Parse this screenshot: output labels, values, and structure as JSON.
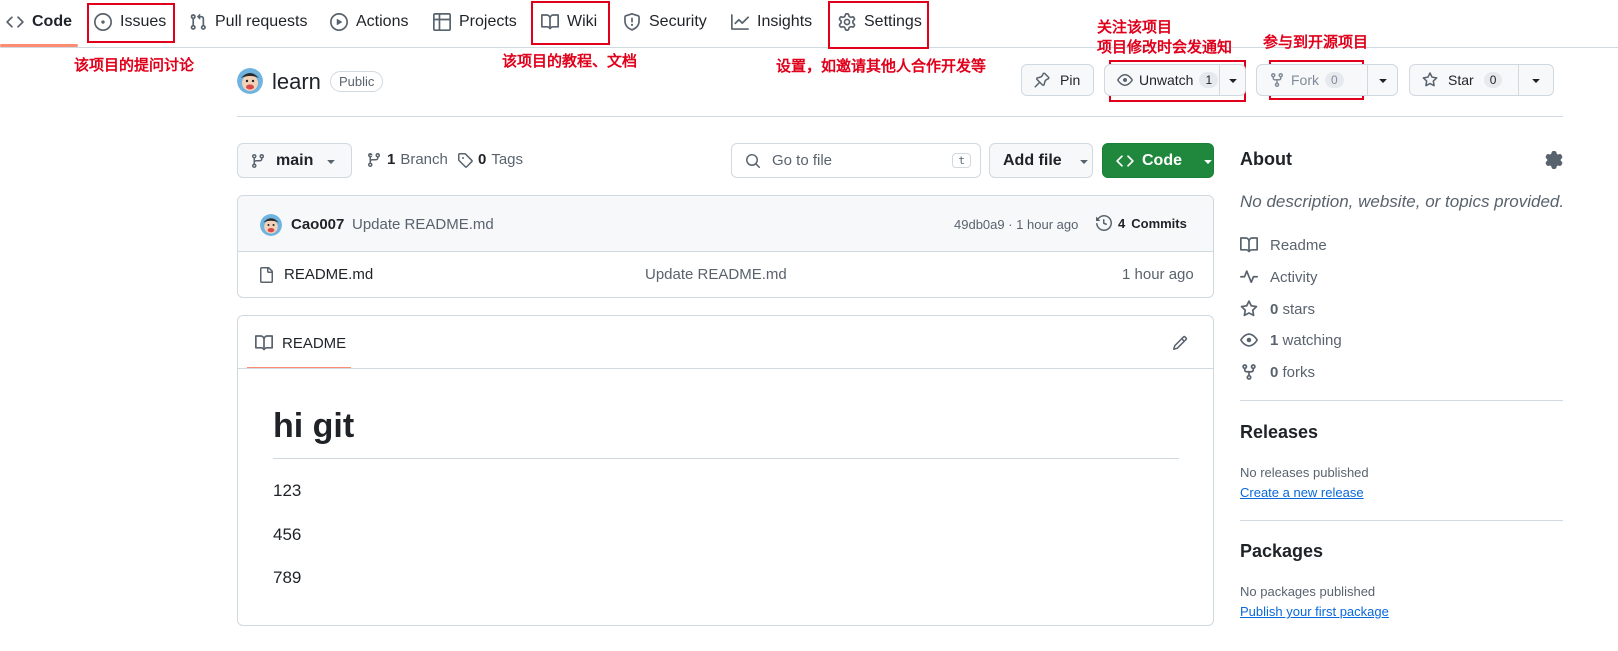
{
  "nav": {
    "tabs": [
      {
        "label": "Code",
        "icon": "code-icon"
      },
      {
        "label": "Issues",
        "icon": "issue-opened-icon"
      },
      {
        "label": "Pull requests",
        "icon": "git-pull-request-icon"
      },
      {
        "label": "Actions",
        "icon": "play-icon"
      },
      {
        "label": "Projects",
        "icon": "table-icon"
      },
      {
        "label": "Wiki",
        "icon": "book-icon"
      },
      {
        "label": "Security",
        "icon": "shield-icon"
      },
      {
        "label": "Insights",
        "icon": "graph-icon"
      },
      {
        "label": "Settings",
        "icon": "gear-icon"
      }
    ]
  },
  "annotations": {
    "issues": "该项目的提问讨论",
    "wiki": "该项目的教程、文档",
    "settings": "设置，如邀请其他人合作开发等",
    "watch_line1": "关注该项目",
    "watch_line2": "项目修改时会发通知",
    "fork": "参与到开源项目"
  },
  "repo": {
    "name": "learn",
    "visibility": "Public",
    "pin_label": "Pin",
    "watch_label": "Unwatch",
    "watch_count": "1",
    "fork_label": "Fork",
    "fork_count": "0",
    "star_label": "Star",
    "star_count": "0"
  },
  "toolbar": {
    "branch": "main",
    "branches_count": "1",
    "branches_label": "Branch",
    "tags_count": "0",
    "tags_label": "Tags",
    "search_placeholder": "Go to file",
    "search_shortcut": "t",
    "add_file_label": "Add file",
    "code_label": "Code"
  },
  "commit": {
    "author": "Cao007",
    "message": "Update README.md",
    "hash_time": "49db0a9 · 1 hour ago",
    "commits_count": "4",
    "commits_label": "Commits"
  },
  "files": [
    {
      "name": "README.md",
      "message": "Update README.md",
      "time": "1 hour ago"
    }
  ],
  "readme": {
    "tab_label": "README",
    "heading": "hi git",
    "paragraphs": [
      "123",
      "456",
      "789"
    ]
  },
  "about": {
    "title": "About",
    "description": "No description, website, or topics provided.",
    "readme": "Readme",
    "activity": "Activity",
    "stars_count": "0",
    "stars_label": "stars",
    "watching_count": "1",
    "watching_label": "watching",
    "forks_count": "0",
    "forks_label": "forks"
  },
  "releases": {
    "title": "Releases",
    "empty": "No releases published",
    "link": "Create a new release"
  },
  "packages": {
    "title": "Packages",
    "empty": "No packages published",
    "link": "Publish your first package"
  },
  "colors": {
    "annotation_red": "#e0001b",
    "active_tab_underline": "#fd8c73",
    "primary_green": "#1f883d",
    "link_blue": "#0969da"
  }
}
